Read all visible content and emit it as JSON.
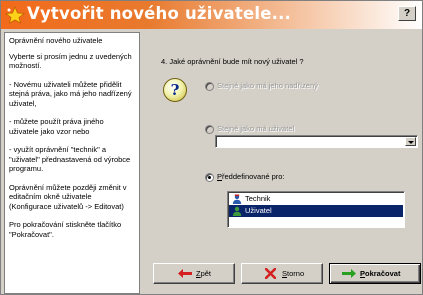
{
  "window": {
    "title": "Vytvořit nového uživatele...",
    "help_label": "?"
  },
  "sidebar": {
    "paragraphs": [
      "Oprávnění nového uživatele",
      "Vyberte si prosím jednu z uvedených možností.",
      "- Novému uživateli můžete přidělit stejná práva, jako má jeho nadřízený uživatel,",
      "- můžete použít práva jiného uživatele jako vzor nebo",
      "- využít oprávnění \"technik\" a \"uživatel\" přednastavená od výrobce programu.",
      "Oprávnění můžete později změnit v editačním okně uživatele (Konfigurace uživatelů -> Editovat)",
      "Pro pokračování stiskněte tlačítko \"Pokračovat\"."
    ]
  },
  "main": {
    "question": "4. Jaké oprávnění bude mít nový uživatel ?",
    "options": [
      {
        "label": "Stejné jako má jeho nadřízený",
        "checked": false,
        "enabled": false
      },
      {
        "label": "Stejné jako má uživatel",
        "checked": false,
        "enabled": false
      },
      {
        "label": "Předdefinované pro:",
        "checked": true,
        "enabled": true
      }
    ],
    "user_combo": {
      "value": ""
    },
    "predefined_list": [
      {
        "label": "Technik",
        "selected": false
      },
      {
        "label": "Uživatel",
        "selected": true
      }
    ]
  },
  "buttons": {
    "back": {
      "accel": "Z",
      "rest": "pět",
      "icon": "arrow-left-icon"
    },
    "cancel": {
      "accel": "S",
      "rest": "torno",
      "icon": "x-icon"
    },
    "next": {
      "accel": "P",
      "rest": "okračovat",
      "icon": "arrow-right-icon"
    }
  },
  "colors": {
    "title_gradient_start": "#f26a1a",
    "selection": "#0a246a",
    "face": "#d4d0c8",
    "back_arrow": "#d42020",
    "cancel_x": "#d42020",
    "next_arrow": "#2aa020"
  }
}
